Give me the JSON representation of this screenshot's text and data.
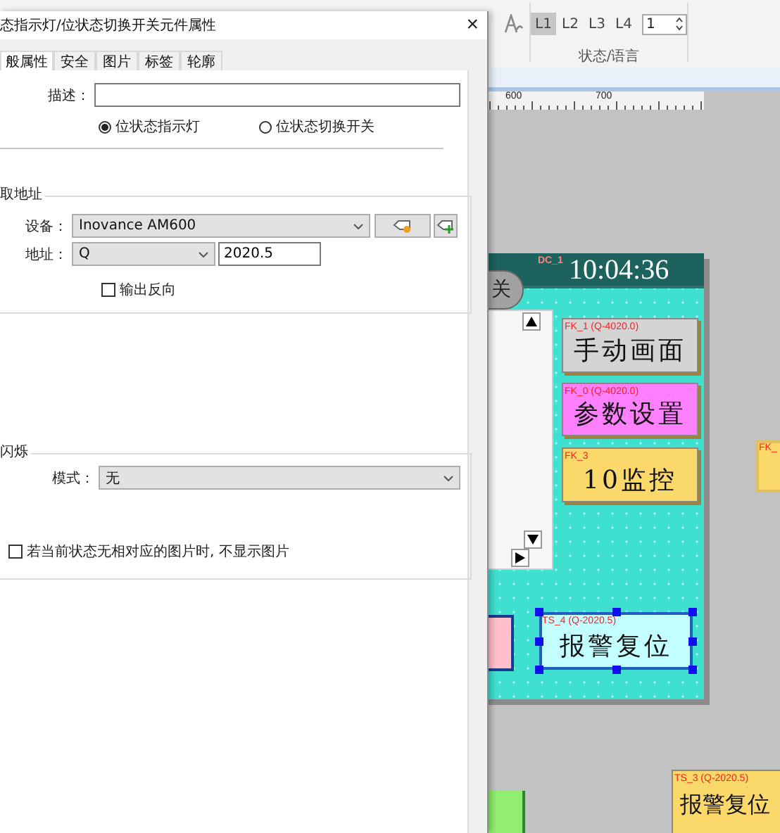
{
  "dialog": {
    "title": "态指示灯/位状态切换开关元件属性",
    "close": "×",
    "tabs": [
      {
        "label": "般属性",
        "selected": true
      },
      {
        "label": "安全",
        "selected": false
      },
      {
        "label": "图片",
        "selected": false
      },
      {
        "label": "标签",
        "selected": false
      },
      {
        "label": "轮廓",
        "selected": false
      }
    ],
    "description": {
      "label": "描述："
    },
    "type_options": [
      {
        "label": "位状态指示灯",
        "selected": true
      },
      {
        "label": "位状态切换开关",
        "selected": false
      }
    ],
    "read_address": {
      "title": "取地址",
      "device_label": "设备：",
      "device": "Inovance AM600",
      "address_label": "地址：",
      "address_type": "Q",
      "address": "2020.5",
      "invert": {
        "label": "输出反向",
        "checked": false
      }
    },
    "blink": {
      "title": "闪烁",
      "mode_label": "模式：",
      "mode": "无"
    },
    "hide_picture": {
      "label": "若当前状态无相对应的图片时, 不显示图片",
      "checked": false
    }
  },
  "ribbon": {
    "levels": [
      {
        "label": "L1",
        "selected": true
      },
      {
        "label": "L2",
        "selected": false
      },
      {
        "label": "L3",
        "selected": false
      },
      {
        "label": "L4",
        "selected": false
      }
    ],
    "spin_value": "1",
    "group_label": "状态/语言"
  },
  "ruler": {
    "ticks": [
      "600",
      "700"
    ]
  },
  "canvas": {
    "screen": {
      "tag": "DC_1",
      "time": "10:04:36",
      "partial_button": "关"
    },
    "buttons": [
      {
        "tag": "FK_1 (Q-4020.0)",
        "label": "手动画面",
        "color": "#d4d4d4",
        "selected": false
      },
      {
        "tag": "FK_0 (Q-4020.0)",
        "label": "参数设置",
        "color": "#ff80ff",
        "selected": false
      },
      {
        "tag": "FK_3",
        "label": "10监控",
        "color": "#fad86a",
        "selected": false
      },
      {
        "tag": "TS_4 (Q-2020.5)",
        "label": "报警复位",
        "color": "#c4ffff",
        "selected": true
      }
    ],
    "outside": [
      {
        "tag": "FK_"
      },
      {
        "tag": "TS_3 (Q-2020.5)",
        "label": "报警复位"
      }
    ]
  }
}
